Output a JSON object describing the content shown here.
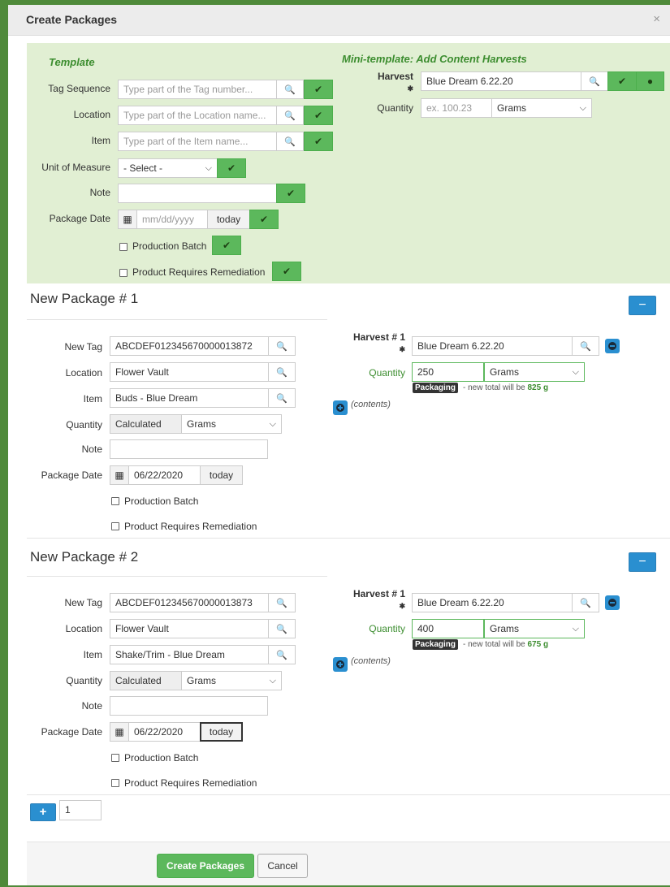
{
  "dialog": {
    "title": "Create Packages",
    "close": "×"
  },
  "template": {
    "heading": "Template",
    "tag_sequence_label": "Tag Sequence",
    "tag_sequence_placeholder": "Type part of the Tag number...",
    "location_label": "Location",
    "location_placeholder": "Type part of the Location name...",
    "item_label": "Item",
    "item_placeholder": "Type part of the Item name...",
    "uom_label": "Unit of Measure",
    "uom_value": "- Select -",
    "note_label": "Note",
    "package_date_label": "Package Date",
    "package_date_placeholder": "mm/dd/yyyy",
    "today": "today",
    "production_batch": "Production Batch",
    "remediation": "Product Requires Remediation"
  },
  "mini_template": {
    "heading": "Mini-template: Add Content Harvests",
    "harvest_label": "Harvest",
    "harvest_value": "Blue Dream 6.22.20",
    "quantity_label": "Quantity",
    "quantity_placeholder": "ex. 100.23",
    "unit": "Grams"
  },
  "packages": [
    {
      "title": "New Package # 1",
      "new_tag_label": "New Tag",
      "new_tag": "ABCDEF012345670000013872",
      "location_label": "Location",
      "location": "Flower Vault",
      "item_label": "Item",
      "item": "Buds - Blue Dream",
      "quantity_label": "Quantity",
      "quantity": "Calculated",
      "unit": "Grams",
      "note_label": "Note",
      "date_label": "Package Date",
      "date": "06/22/2020",
      "today": "today",
      "production_batch": "Production Batch",
      "remediation": "Product Requires Remediation",
      "harvest_label": "Harvest # 1",
      "harvest": "Blue Dream 6.22.20",
      "h_quantity_label": "Quantity",
      "h_quantity": "250",
      "h_unit": "Grams",
      "badge": "Packaging",
      "note_prefix": "- new total will be",
      "new_total": "825 g",
      "contents": "(contents)"
    },
    {
      "title": "New Package # 2",
      "new_tag_label": "New Tag",
      "new_tag": "ABCDEF012345670000013873",
      "location_label": "Location",
      "location": "Flower Vault",
      "item_label": "Item",
      "item": "Shake/Trim - Blue Dream",
      "quantity_label": "Quantity",
      "quantity": "Calculated",
      "unit": "Grams",
      "note_label": "Note",
      "date_label": "Package Date",
      "date": "06/22/2020",
      "today": "today",
      "production_batch": "Production Batch",
      "remediation": "Product Requires Remediation",
      "harvest_label": "Harvest # 1",
      "harvest": "Blue Dream 6.22.20",
      "h_quantity_label": "Quantity",
      "h_quantity": "400",
      "h_unit": "Grams",
      "badge": "Packaging",
      "note_prefix": "- new total will be",
      "new_total": "675 g",
      "contents": "(contents)"
    }
  ],
  "add_count": "1",
  "footer": {
    "create": "Create Packages",
    "cancel": "Cancel"
  },
  "icons": {
    "search": "search-icon",
    "check": "check-icon",
    "calendar": "calendar-icon",
    "minus": "minus-icon",
    "plus": "plus-icon"
  }
}
